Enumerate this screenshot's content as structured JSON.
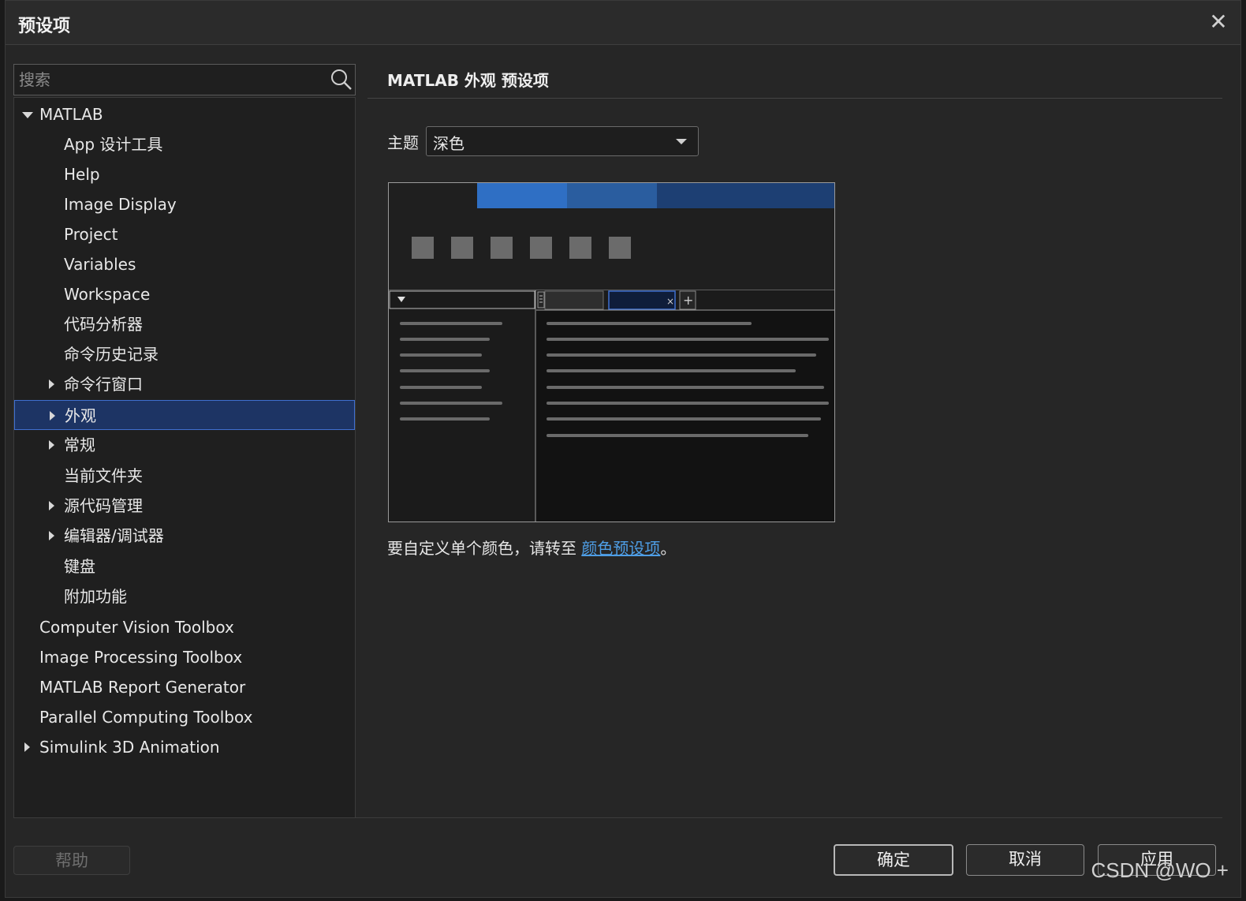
{
  "dialog": {
    "title": "预设项",
    "close_glyph": "✕"
  },
  "search": {
    "placeholder": "搜索",
    "icon": "search-icon"
  },
  "tree": {
    "items": [
      {
        "label": "MATLAB",
        "caret": "down"
      },
      {
        "label": "App 设计工具",
        "caret": "none"
      },
      {
        "label": "Help",
        "caret": "none"
      },
      {
        "label": "Image Display",
        "caret": "none"
      },
      {
        "label": "Project",
        "caret": "none"
      },
      {
        "label": "Variables",
        "caret": "none"
      },
      {
        "label": "Workspace",
        "caret": "none"
      },
      {
        "label": "代码分析器",
        "caret": "none"
      },
      {
        "label": "命令历史记录",
        "caret": "none"
      },
      {
        "label": "命令行窗口",
        "caret": "right"
      },
      {
        "label": "外观",
        "caret": "right",
        "selected": true
      },
      {
        "label": "常规",
        "caret": "right"
      },
      {
        "label": "当前文件夹",
        "caret": "none"
      },
      {
        "label": "源代码管理",
        "caret": "right"
      },
      {
        "label": "编辑器/调试器",
        "caret": "right"
      },
      {
        "label": "键盘",
        "caret": "none"
      },
      {
        "label": "附加功能",
        "caret": "none"
      },
      {
        "label": "Computer Vision Toolbox",
        "caret": "none"
      },
      {
        "label": "Image Processing Toolbox",
        "caret": "none"
      },
      {
        "label": "MATLAB Report Generator",
        "caret": "none"
      },
      {
        "label": "Parallel Computing Toolbox",
        "caret": "none"
      },
      {
        "label": "Simulink 3D Animation",
        "caret": "right"
      }
    ]
  },
  "main": {
    "section_title": "MATLAB 外观 预设项",
    "theme_label": "主题",
    "theme_value": "深色",
    "hint_prefix": "要自定义单个颜色，请转至 ",
    "hint_link": "颜色预设项",
    "hint_suffix": "。",
    "preview_tab_close": "×",
    "preview_tab_add": "+"
  },
  "colors": {
    "accent": "#3f6fd0",
    "selection_bg": "#1d3464",
    "link": "#4e9ee6",
    "preview_tab_1": "#2f6fc4",
    "preview_tab_2": "#2a5d9f",
    "preview_tab_3": "#1d3f73"
  },
  "footer": {
    "help": "帮助",
    "ok": "确定",
    "cancel": "取消",
    "apply": "应用"
  },
  "watermark": "CSDN @WO +"
}
